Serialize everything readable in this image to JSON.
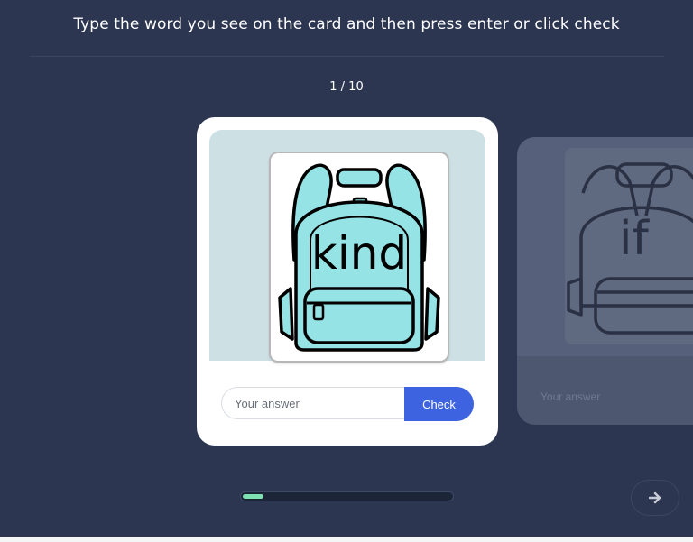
{
  "instruction": "Type the word you see on the card and then press enter or click check",
  "counter": "1 / 10",
  "current_card": {
    "word": "kind",
    "image": "backpack-illustration",
    "answer_placeholder": "Your answer",
    "check_label": "Check"
  },
  "next_card": {
    "word": "if",
    "image": "backpack-illustration",
    "answer_placeholder": "Your answer"
  },
  "progress": {
    "current": 1,
    "total": 10,
    "fraction": 0.1
  },
  "icons": {
    "next": "arrow-right-icon"
  },
  "colors": {
    "background": "#2c3651",
    "accent": "#3d63e0",
    "progress": "#7fe0b0",
    "backpack": "#96e3e6"
  }
}
